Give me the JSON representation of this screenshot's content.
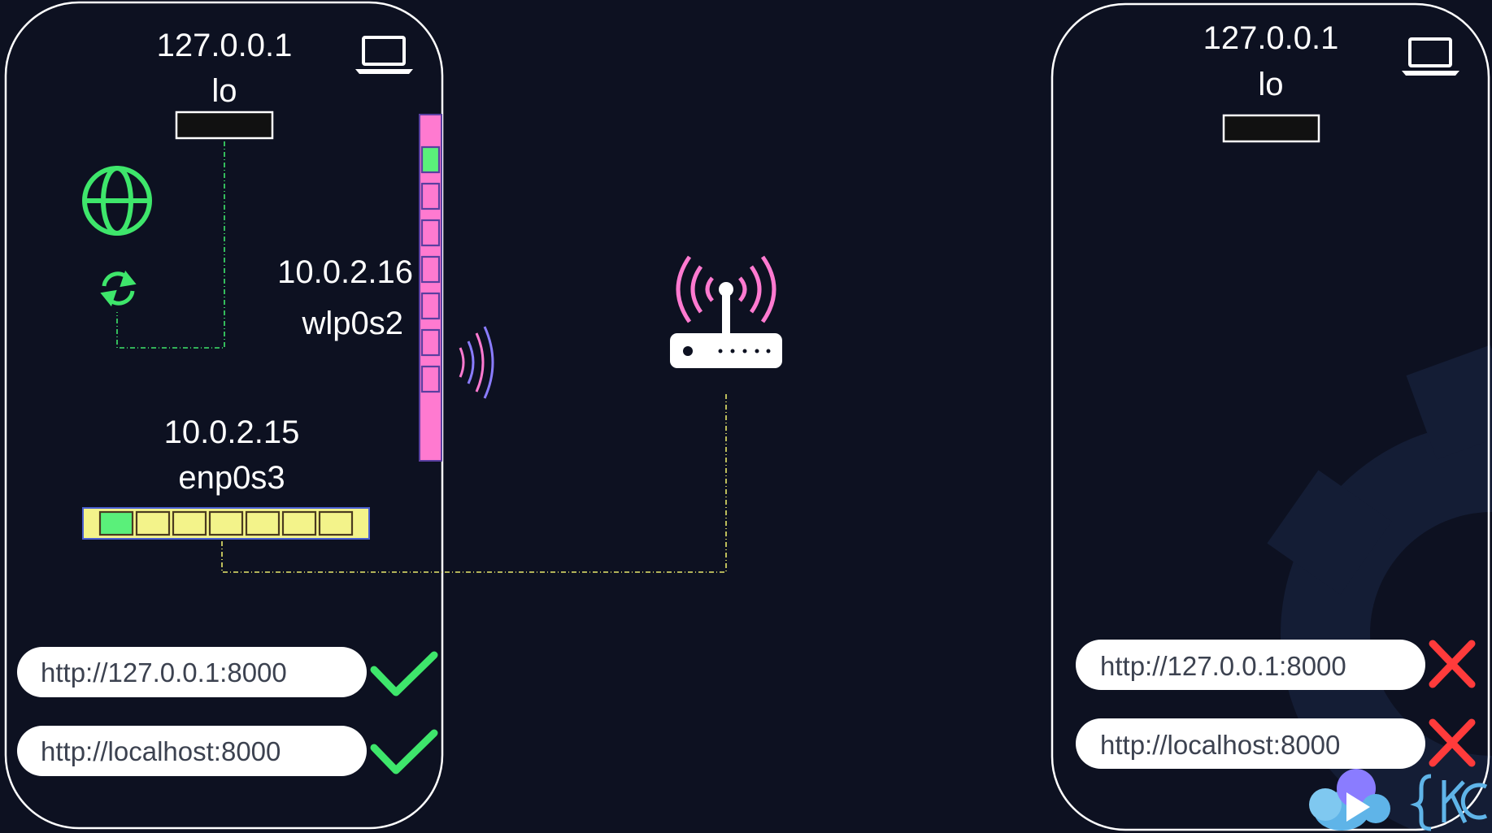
{
  "left_host": {
    "loopback": {
      "ip": "127.0.0.1",
      "name": "lo"
    },
    "wireless": {
      "ip": "10.0.2.16",
      "name": "wlp0s2"
    },
    "ethernet": {
      "ip": "10.0.2.15",
      "name": "enp0s3"
    },
    "urls": [
      {
        "text": "http://127.0.0.1:8000",
        "status": "ok"
      },
      {
        "text": "http://localhost:8000",
        "status": "ok"
      }
    ]
  },
  "right_host": {
    "loopback": {
      "ip": "127.0.0.1",
      "name": "lo"
    },
    "urls": [
      {
        "text": "http://127.0.0.1:8000",
        "status": "fail"
      },
      {
        "text": "http://localhost:8000",
        "status": "fail"
      }
    ]
  },
  "icons": [
    "laptop-icon",
    "globe-icon",
    "refresh-icon",
    "wifi-waves-icon",
    "wireless-router-icon",
    "check-icon",
    "cross-icon",
    "cloud-play-logo-icon"
  ],
  "colors": {
    "background": "#0d1121",
    "frame": "#ffffff",
    "ok": "#3ee66b",
    "fail": "#ff3b3b",
    "wireless_nic": "#ff7ad0",
    "ethernet_nic": "#f3f38a",
    "port_active": "#5af07a",
    "link_green": "#3ee66b",
    "link_yellow": "#e8e86a"
  }
}
